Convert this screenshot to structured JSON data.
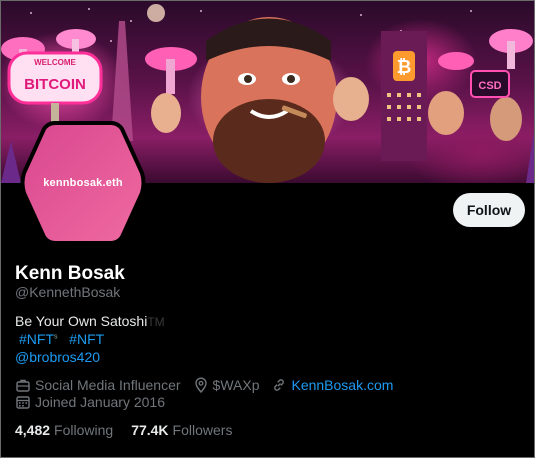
{
  "profile": {
    "avatar_text": "kennbosak.eth",
    "display_name": "Kenn Bosak",
    "handle": "@KennethBosak",
    "follow_label": "Follow",
    "bio_line1": "Be Your Own Satoshi",
    "bio_tm": "TM",
    "hashtag1": "#NFT",
    "hashtag1_sup": "s",
    "hashtag2": "#NFT",
    "mention": "@brobros420",
    "category": "Social Media Influencer",
    "location": "$WAXp",
    "website": "KennBosak.com",
    "joined": "Joined January 2016",
    "following_count": "4,482",
    "following_label": "Following",
    "followers_count": "77.4K",
    "followers_label": "Followers"
  },
  "banner": {
    "sign_top": "WELCOME",
    "sign_main": "BITCOIN",
    "sign_right": "CSD",
    "bitcoin_symbol": "₿"
  },
  "colors": {
    "accent": "#1d9bf0",
    "avatar_pink": "#e8478f",
    "banner_pink": "#ff4fb0"
  }
}
